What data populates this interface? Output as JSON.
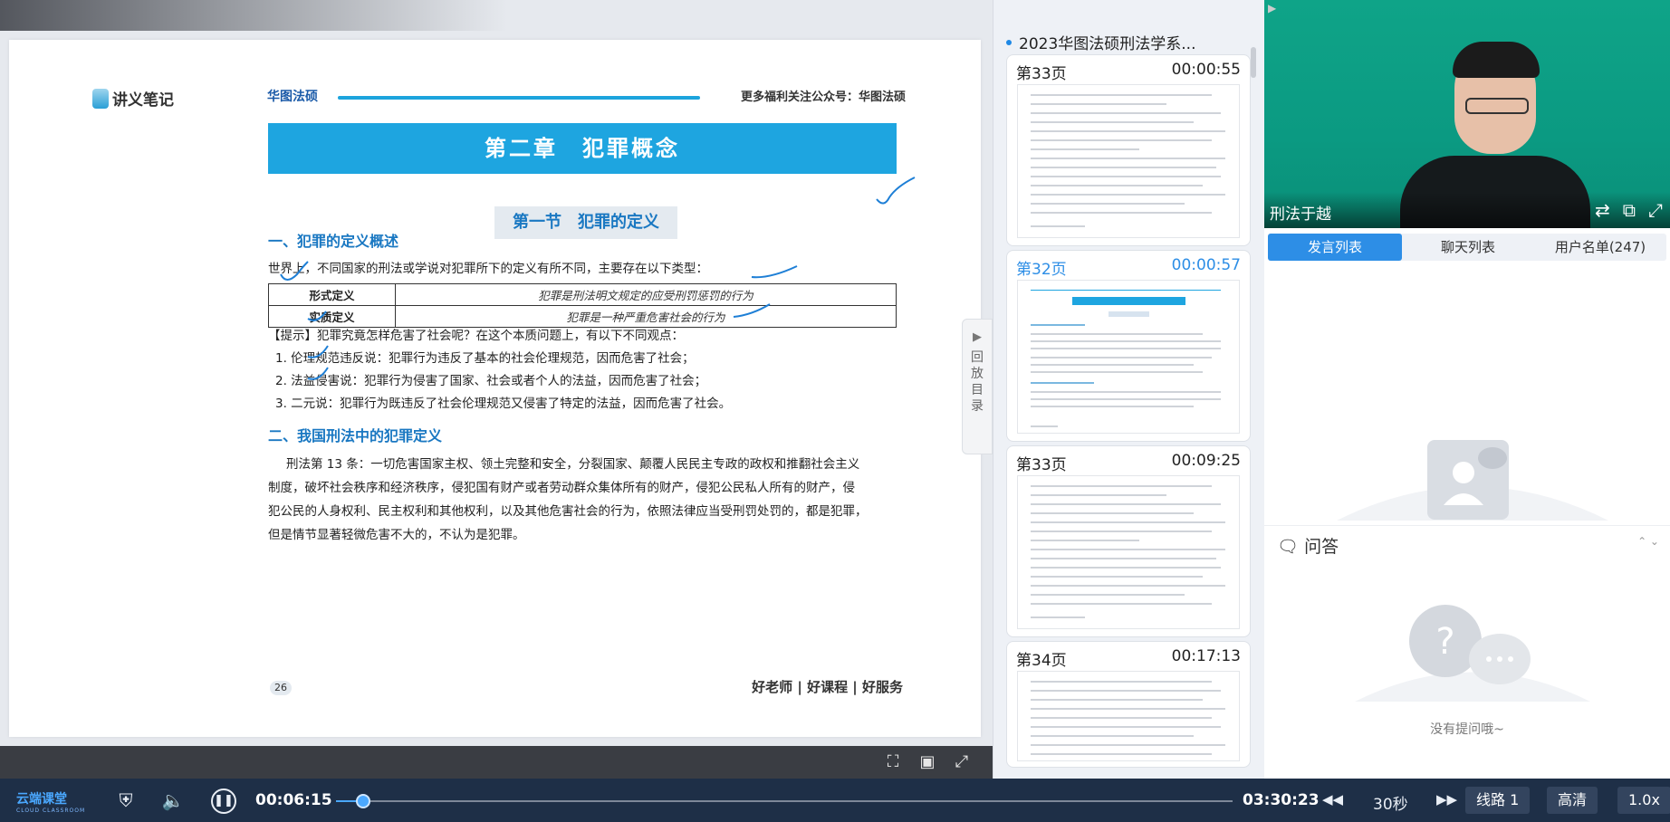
{
  "slide": {
    "notes_logo": "讲义笔记",
    "brand": "华图法硕",
    "public_account": "更多福利关注公众号：华图法硕",
    "chapter_title": "第二章　犯罪概念",
    "section_title": "第一节　犯罪的定义",
    "heading1": "一、犯罪的定义概述",
    "intro": "世界上，不同国家的刑法或学说对犯罪所下的定义有所不同，主要存在以下类型：",
    "table": [
      {
        "term": "形式定义",
        "definition": "犯罪是刑法明文规定的应受刑罚惩罚的行为"
      },
      {
        "term": "实质定义",
        "definition": "犯罪是一种严重危害社会的行为"
      }
    ],
    "hint": "【提示】犯罪究竟怎样危害了社会呢？在这个本质问题上，有以下不同观点：",
    "points": [
      "1. 伦理规范违反说：犯罪行为违反了基本的社会伦理规范，因而危害了社会；",
      "2. 法益侵害说：犯罪行为侵害了国家、社会或者个人的法益，因而危害了社会；",
      "3. 二元说：犯罪行为既违反了社会伦理规范又侵害了特定的法益，因而危害了社会。"
    ],
    "heading2": "二、我国刑法中的犯罪定义",
    "article_lines": [
      "刑法第 13 条：一切危害国家主权、领土完整和安全，分裂国家、颠覆人民民主专政的政权和推翻社会主义",
      "制度，破坏社会秩序和经济秩序，侵犯国有财产或者劳动群众集体所有的财产，侵犯公民私人所有的财产，侵",
      "犯公民的人身权利、民主权利和其他权利，以及其他危害社会的行为，依照法律应当受刑罚处罚的，都是犯罪，",
      "但是情节显著轻微危害不大的，不认为是犯罪。"
    ],
    "page_number": "26",
    "footer_slogan": "好老师 | 好课程 | 好服务"
  },
  "replay_tab": {
    "label": "回放目录",
    "arrow": "▶"
  },
  "thumbs": {
    "title": "2023华图法硕刑法学系...",
    "items": [
      {
        "page": "第33页",
        "time": "00:00:55",
        "active": false
      },
      {
        "page": "第32页",
        "time": "00:00:57",
        "active": true
      },
      {
        "page": "第33页",
        "time": "00:09:25",
        "active": false
      },
      {
        "page": "第34页",
        "time": "00:17:13",
        "active": false
      }
    ]
  },
  "video": {
    "name": "刑法于越",
    "icons": [
      "switch-icon",
      "popout-icon",
      "fullscreen-icon"
    ]
  },
  "tabs": {
    "speech": "发言列表",
    "chat": "聊天列表",
    "users": "用户名单(247)"
  },
  "qa": {
    "label": "问答",
    "empty_text": "没有提问哦~"
  },
  "player": {
    "logo": "云端课堂",
    "logo_sub": "CLOUD CLASSROOM",
    "current_time": "00:06:15",
    "total_time": "03:30:23",
    "progress": 0.03,
    "skip_label": "30秒",
    "line_label": "线路 1",
    "quality_label": "高清",
    "speed_label": "1.0x"
  },
  "colors": {
    "accent": "#2d8ee6",
    "chapter": "#1ea5e0",
    "player_bg": "#1e2f47",
    "video_bg": "#0fa488"
  }
}
